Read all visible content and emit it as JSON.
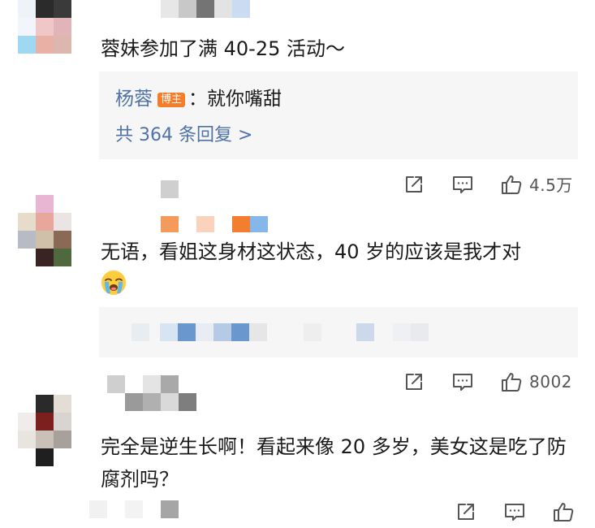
{
  "comments": [
    {
      "text": "蓉妹参加了满 40-25 活动～",
      "reply": {
        "author": "杨蓉",
        "badge": "博主",
        "separator": "：",
        "text": "就你嘴甜",
        "count_label": "共 364 条回复 >"
      },
      "likes": "4.5万"
    },
    {
      "text": "无语，看姐这身材这状态，40 岁的应该是我才对",
      "emoji": "crying-face",
      "likes": "8002"
    },
    {
      "text": "完全是逆生长啊！看起来像 20 多岁，美女这是吃了防腐剂吗？",
      "likes": ""
    }
  ],
  "icons": {
    "share": "share-icon",
    "comment": "comment-icon",
    "like": "thumbs-up-icon"
  },
  "colors": {
    "link": "#4f72a8",
    "badge": "#f57c2a",
    "reply_bg": "#f6f6f6",
    "icon": "#555555"
  }
}
